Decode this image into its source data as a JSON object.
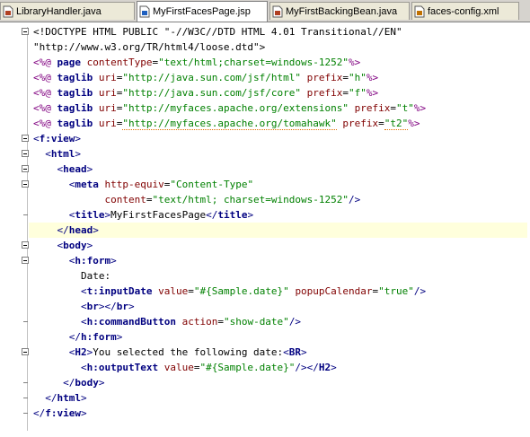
{
  "tabs": [
    {
      "label": "LibraryHandler.java",
      "icon": "java-file-icon",
      "active": false
    },
    {
      "label": "MyFirstFacesPage.jsp",
      "icon": "jsp-file-icon",
      "active": true
    },
    {
      "label": "MyFirstBackingBean.java",
      "icon": "java-file-icon",
      "active": false
    },
    {
      "label": "faces-config.xml",
      "icon": "xml-file-icon",
      "active": false
    }
  ],
  "code": [
    [
      [
        "<!DOCTYPE HTML PUBLIC \"-//W3C//DTD HTML 4.01 Transitional//EN\"",
        "text"
      ]
    ],
    [
      [
        "\"http://www.w3.org/TR/html4/loose.dtd\">",
        "text"
      ]
    ],
    [
      [
        "<%@ ",
        "dir"
      ],
      [
        "page ",
        "tag"
      ],
      [
        "contentType",
        "attr"
      ],
      [
        "=",
        "text"
      ],
      [
        "\"text/html;charset=windows-1252\"",
        "val"
      ],
      [
        "%>",
        "dir"
      ]
    ],
    [
      [
        "<%@ ",
        "dir"
      ],
      [
        "taglib ",
        "tag"
      ],
      [
        "uri",
        "attr"
      ],
      [
        "=",
        "text"
      ],
      [
        "\"http://java.sun.com/jsf/html\"",
        "val"
      ],
      [
        " ",
        "text"
      ],
      [
        "prefix",
        "attr"
      ],
      [
        "=",
        "text"
      ],
      [
        "\"h\"",
        "val"
      ],
      [
        "%>",
        "dir"
      ]
    ],
    [
      [
        "<%@ ",
        "dir"
      ],
      [
        "taglib ",
        "tag"
      ],
      [
        "uri",
        "attr"
      ],
      [
        "=",
        "text"
      ],
      [
        "\"http://java.sun.com/jsf/core\"",
        "val"
      ],
      [
        " ",
        "text"
      ],
      [
        "prefix",
        "attr"
      ],
      [
        "=",
        "text"
      ],
      [
        "\"f\"",
        "val"
      ],
      [
        "%>",
        "dir"
      ]
    ],
    [
      [
        "<%@ ",
        "dir"
      ],
      [
        "taglib ",
        "tag"
      ],
      [
        "uri",
        "attr"
      ],
      [
        "=",
        "text"
      ],
      [
        "\"http://myfaces.apache.org/extensions\"",
        "val"
      ],
      [
        " ",
        "text"
      ],
      [
        "prefix",
        "attr"
      ],
      [
        "=",
        "text"
      ],
      [
        "\"t\"",
        "val"
      ],
      [
        "%>",
        "dir"
      ]
    ],
    [
      [
        "<%@ ",
        "dir"
      ],
      [
        "taglib ",
        "tag"
      ],
      [
        "uri",
        "attr"
      ],
      [
        "=",
        "text"
      ],
      [
        "\"http://myfaces.apache.org/tomahawk\"",
        "val"
      ],
      [
        " ",
        "text"
      ],
      [
        "prefix",
        "attr"
      ],
      [
        "=",
        "text"
      ],
      [
        "\"t2\"",
        "val"
      ],
      [
        "%>",
        "dir"
      ]
    ],
    [
      [
        "<",
        "punc"
      ],
      [
        "f:view",
        "tag"
      ],
      [
        ">",
        "punc"
      ]
    ],
    [
      [
        "  ",
        "text"
      ],
      [
        "<",
        "punc"
      ],
      [
        "html",
        "tag"
      ],
      [
        ">",
        "punc"
      ]
    ],
    [
      [
        "    ",
        "text"
      ],
      [
        "<",
        "punc"
      ],
      [
        "head",
        "tag"
      ],
      [
        ">",
        "punc"
      ]
    ],
    [
      [
        "      ",
        "text"
      ],
      [
        "<",
        "punc"
      ],
      [
        "meta ",
        "tag"
      ],
      [
        "http-equiv",
        "attr"
      ],
      [
        "=",
        "text"
      ],
      [
        "\"Content-Type\"",
        "val"
      ]
    ],
    [
      [
        "            ",
        "text"
      ],
      [
        "content",
        "attr"
      ],
      [
        "=",
        "text"
      ],
      [
        "\"text/html; charset=windows-1252\"",
        "val"
      ],
      [
        "/>",
        "punc"
      ]
    ],
    [
      [
        "      ",
        "text"
      ],
      [
        "<",
        "punc"
      ],
      [
        "title",
        "tag"
      ],
      [
        ">",
        "punc"
      ],
      [
        "MyFirstFacesPage",
        "text"
      ],
      [
        "</",
        "punc"
      ],
      [
        "title",
        "tag"
      ],
      [
        ">",
        "punc"
      ]
    ],
    [
      [
        "    ",
        "text"
      ],
      [
        "</",
        "punc"
      ],
      [
        "head",
        "tag"
      ],
      [
        ">",
        "punc"
      ]
    ],
    [
      [
        "    ",
        "text"
      ],
      [
        "<",
        "punc"
      ],
      [
        "body",
        "tag"
      ],
      [
        ">",
        "punc"
      ]
    ],
    [
      [
        "      ",
        "text"
      ],
      [
        "<",
        "punc"
      ],
      [
        "h:form",
        "tag"
      ],
      [
        ">",
        "punc"
      ]
    ],
    [
      [
        "        Date:",
        "text"
      ]
    ],
    [
      [
        "        ",
        "text"
      ],
      [
        "<",
        "punc"
      ],
      [
        "t:inputDate ",
        "tag"
      ],
      [
        "value",
        "attr"
      ],
      [
        "=",
        "text"
      ],
      [
        "\"#{Sample.date}\"",
        "val"
      ],
      [
        " ",
        "text"
      ],
      [
        "popupCalendar",
        "attr"
      ],
      [
        "=",
        "text"
      ],
      [
        "\"true\"",
        "val"
      ],
      [
        "/>",
        "punc"
      ]
    ],
    [
      [
        "        ",
        "text"
      ],
      [
        "<",
        "punc"
      ],
      [
        "br",
        "tag"
      ],
      [
        "></",
        "punc"
      ],
      [
        "br",
        "tag"
      ],
      [
        ">",
        "punc"
      ]
    ],
    [
      [
        "        ",
        "text"
      ],
      [
        "<",
        "punc"
      ],
      [
        "h:commandButton ",
        "tag"
      ],
      [
        "action",
        "attr"
      ],
      [
        "=",
        "text"
      ],
      [
        "\"show-date\"",
        "val"
      ],
      [
        "/>",
        "punc"
      ]
    ],
    [
      [
        "      ",
        "text"
      ],
      [
        "</",
        "punc"
      ],
      [
        "h:form",
        "tag"
      ],
      [
        ">",
        "punc"
      ]
    ],
    [
      [
        "      ",
        "text"
      ],
      [
        "<",
        "punc"
      ],
      [
        "H2",
        "tag"
      ],
      [
        ">",
        "punc"
      ],
      [
        "You selected the following date:",
        "text"
      ],
      [
        "<",
        "punc"
      ],
      [
        "BR",
        "tag"
      ],
      [
        ">",
        "punc"
      ]
    ],
    [
      [
        "        ",
        "text"
      ],
      [
        "<",
        "punc"
      ],
      [
        "h:outputText ",
        "tag"
      ],
      [
        "value",
        "attr"
      ],
      [
        "=",
        "text"
      ],
      [
        "\"#{Sample.date}\"",
        "val"
      ],
      [
        "/></",
        "punc"
      ],
      [
        "H2",
        "tag"
      ],
      [
        ">",
        "punc"
      ]
    ],
    [
      [
        "     ",
        "text"
      ],
      [
        "</",
        "punc"
      ],
      [
        "body",
        "tag"
      ],
      [
        ">",
        "punc"
      ]
    ],
    [
      [
        "  ",
        "text"
      ],
      [
        "</",
        "punc"
      ],
      [
        "html",
        "tag"
      ],
      [
        ">",
        "punc"
      ]
    ],
    [
      [
        "</",
        "punc"
      ],
      [
        "f:view",
        "tag"
      ],
      [
        ">",
        "punc"
      ]
    ]
  ],
  "highlighted_line": 14,
  "colors": {
    "tag": "#000080",
    "attribute": "#800000",
    "value": "#008000",
    "directive": "#800080",
    "current_line": "#ffffdc"
  }
}
